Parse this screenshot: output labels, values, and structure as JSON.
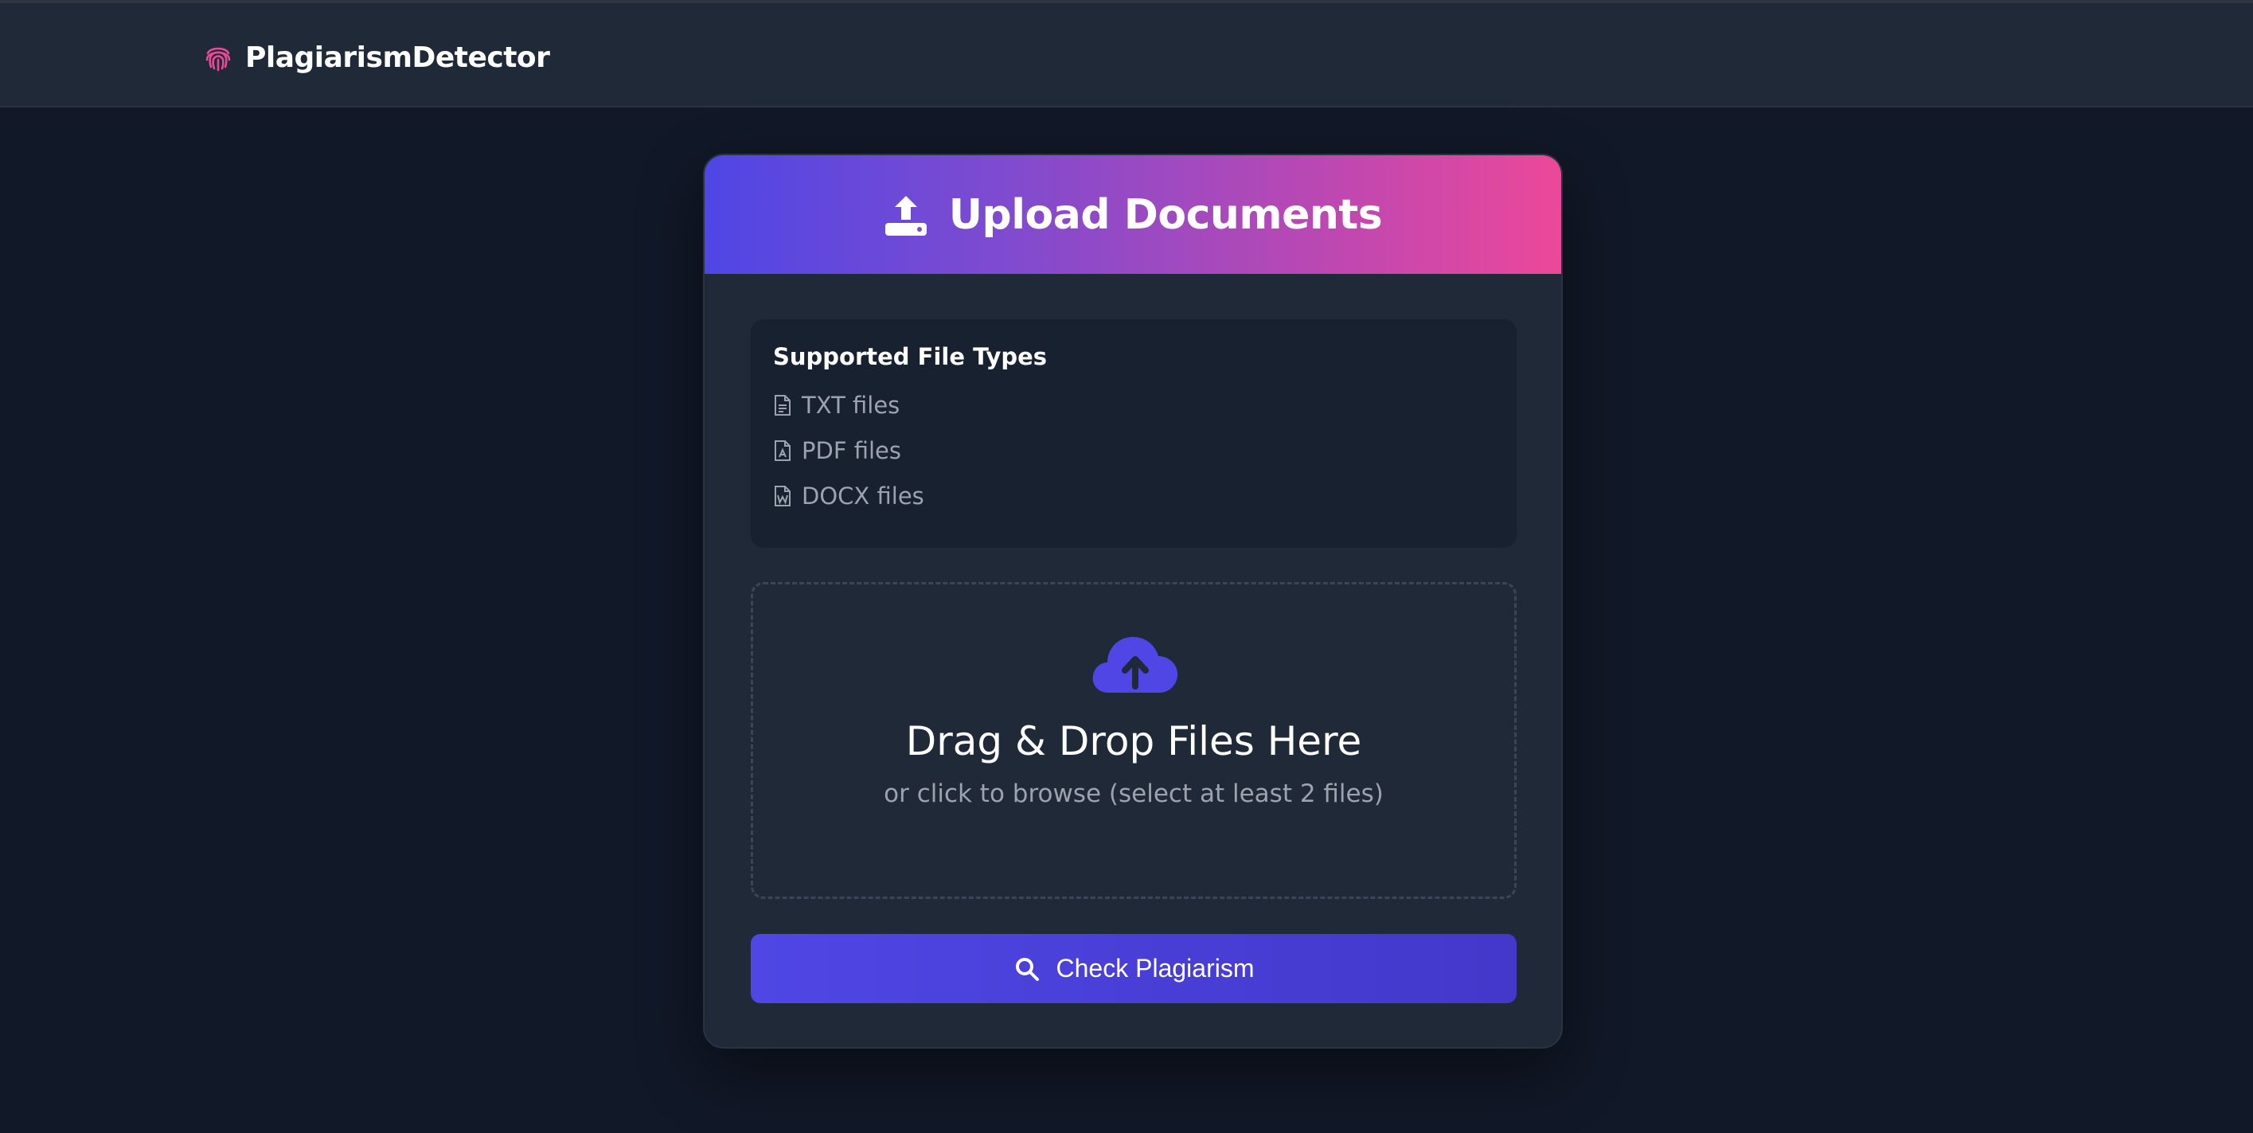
{
  "navbar": {
    "brand_name": "PlagiarismDetector",
    "brand_icon": "fingerprint-icon",
    "brand_icon_color": "#ec4899"
  },
  "upload_card": {
    "title": "Upload Documents",
    "title_icon": "upload-icon",
    "header_gradient": [
      "#4f46e5",
      "#ec4899"
    ],
    "supported_types": {
      "heading": "Supported File Types",
      "items": [
        {
          "label": "TXT files",
          "icon": "file-text-icon"
        },
        {
          "label": "PDF files",
          "icon": "file-pdf-icon"
        },
        {
          "label": "DOCX files",
          "icon": "file-word-icon"
        }
      ]
    },
    "dropzone": {
      "icon": "cloud-upload-icon",
      "title": "Drag & Drop Files Here",
      "subtitle": "or click to browse (select at least 2 files)"
    },
    "check_button": {
      "label": "Check Plagiarism",
      "icon": "search-icon",
      "color": "#4f46e5"
    }
  }
}
